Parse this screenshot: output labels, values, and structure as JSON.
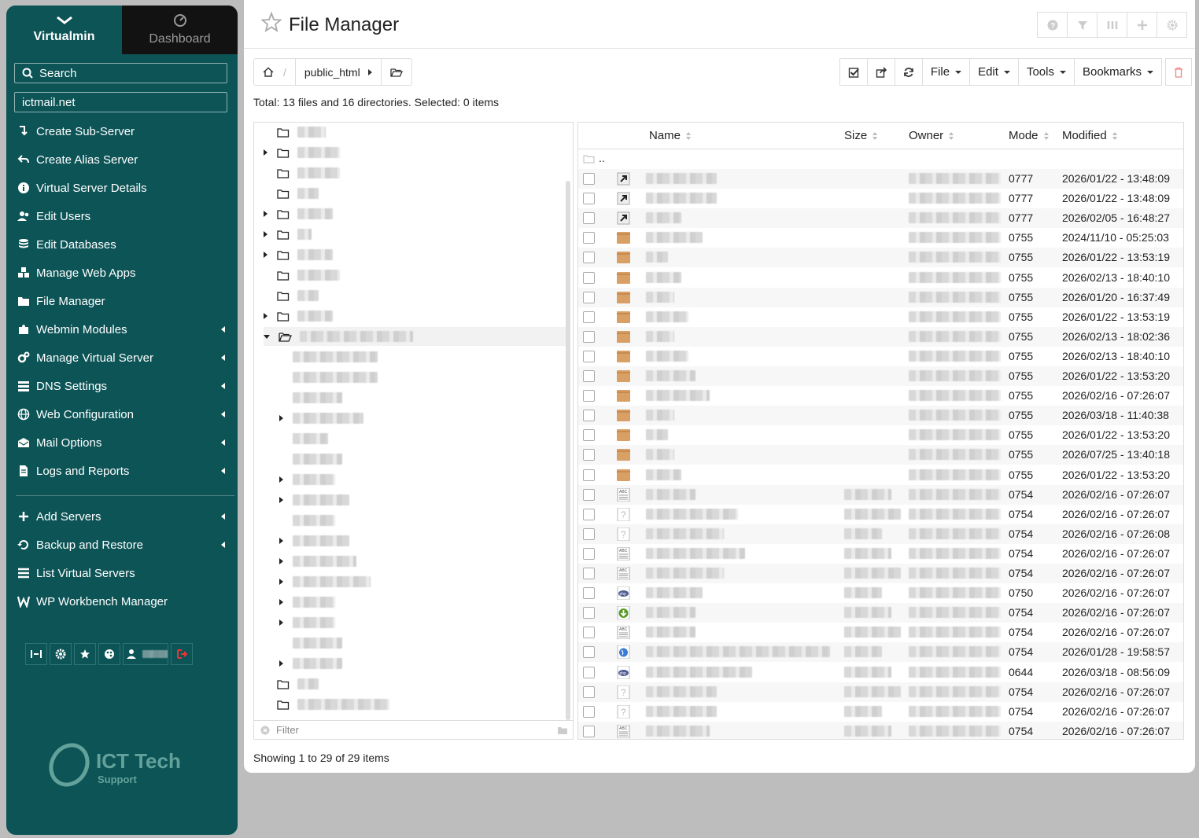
{
  "sidebar": {
    "tab_virtualmin": "Virtualmin",
    "tab_dashboard": "Dashboard",
    "search_placeholder": "Search",
    "domain": "ictmail.net",
    "items": [
      {
        "label": "Create Sub-Server",
        "icon": "level-down-icon",
        "arrow": false
      },
      {
        "label": "Create Alias Server",
        "icon": "reply-icon",
        "arrow": false
      },
      {
        "label": "Virtual Server Details",
        "icon": "info-icon",
        "arrow": false
      },
      {
        "label": "Edit Users",
        "icon": "users-icon",
        "arrow": false
      },
      {
        "label": "Edit Databases",
        "icon": "database-icon",
        "arrow": false
      },
      {
        "label": "Manage Web Apps",
        "icon": "cubes-icon",
        "arrow": false
      },
      {
        "label": "File Manager",
        "icon": "folder-icon",
        "arrow": false
      },
      {
        "label": "Webmin Modules",
        "icon": "puzzle-icon",
        "arrow": true
      },
      {
        "label": "Manage Virtual Server",
        "icon": "cogs-icon",
        "arrow": true
      },
      {
        "label": "DNS Settings",
        "icon": "server-icon",
        "arrow": true
      },
      {
        "label": "Web Configuration",
        "icon": "globe-icon",
        "arrow": true
      },
      {
        "label": "Mail Options",
        "icon": "envelope-icon",
        "arrow": true
      },
      {
        "label": "Logs and Reports",
        "icon": "file-icon",
        "arrow": true
      }
    ],
    "items2": [
      {
        "label": "Add Servers",
        "icon": "plus-icon",
        "arrow": true
      },
      {
        "label": "Backup and Restore",
        "icon": "backup-icon",
        "arrow": true
      },
      {
        "label": "List Virtual Servers",
        "icon": "list-icon",
        "arrow": false
      },
      {
        "label": "WP Workbench Manager",
        "icon": "wp-icon",
        "arrow": false
      }
    ]
  },
  "header": {
    "title": "File Manager"
  },
  "crumb": {
    "folder": "public_html"
  },
  "actions": {
    "file": "File",
    "edit": "Edit",
    "tools": "Tools",
    "bookmarks": "Bookmarks"
  },
  "summary": "Total: 13 files and 16 directories. Selected: 0 items",
  "tree": {
    "filter_placeholder": "Filter"
  },
  "table": {
    "headers": {
      "name": "Name",
      "size": "Size",
      "owner": "Owner",
      "mode": "Mode",
      "modified": "Modified"
    },
    "parent": "..",
    "rows": [
      {
        "type": "link",
        "mode": "0777",
        "modified": "2026/01/22 - 13:48:09",
        "nw": 90
      },
      {
        "type": "link",
        "mode": "0777",
        "modified": "2026/01/22 - 13:48:09",
        "nw": 90
      },
      {
        "type": "link",
        "mode": "0777",
        "modified": "2026/02/05 - 16:48:27",
        "nw": 45
      },
      {
        "type": "folder",
        "mode": "0755",
        "modified": "2024/11/10 - 05:25:03",
        "nw": 72
      },
      {
        "type": "folder",
        "mode": "0755",
        "modified": "2026/01/22 - 13:53:19",
        "nw": 28
      },
      {
        "type": "folder",
        "mode": "0755",
        "modified": "2026/02/13 - 18:40:10",
        "nw": 45
      },
      {
        "type": "folder",
        "mode": "0755",
        "modified": "2026/01/20 - 16:37:49",
        "nw": 36
      },
      {
        "type": "folder",
        "mode": "0755",
        "modified": "2026/01/22 - 13:53:19",
        "nw": 54
      },
      {
        "type": "folder",
        "mode": "0755",
        "modified": "2026/02/13 - 18:02:36",
        "nw": 36
      },
      {
        "type": "folder",
        "mode": "0755",
        "modified": "2026/02/13 - 18:40:10",
        "nw": 54
      },
      {
        "type": "folder",
        "mode": "0755",
        "modified": "2026/01/22 - 13:53:20",
        "nw": 63
      },
      {
        "type": "folder",
        "mode": "0755",
        "modified": "2026/02/16 - 07:26:07",
        "nw": 81
      },
      {
        "type": "folder",
        "mode": "0755",
        "modified": "2026/03/18 - 11:40:38",
        "nw": 36
      },
      {
        "type": "folder",
        "mode": "0755",
        "modified": "2026/01/22 - 13:53:20",
        "nw": 28
      },
      {
        "type": "folder",
        "mode": "0755",
        "modified": "2026/07/25 - 13:40:18",
        "nw": 36
      },
      {
        "type": "folder",
        "mode": "0755",
        "modified": "2026/01/22 - 13:53:20",
        "nw": 45
      },
      {
        "type": "text",
        "mode": "0754",
        "modified": "2026/02/16 - 07:26:07",
        "nw": 63
      },
      {
        "type": "unknown",
        "mode": "0754",
        "modified": "2026/02/16 - 07:26:07",
        "nw": 117
      },
      {
        "type": "unknown",
        "mode": "0754",
        "modified": "2026/02/16 - 07:26:08",
        "nw": 99
      },
      {
        "type": "text",
        "mode": "0754",
        "modified": "2026/02/16 - 07:26:07",
        "nw": 126
      },
      {
        "type": "text",
        "mode": "0754",
        "modified": "2026/02/16 - 07:26:07",
        "nw": 99
      },
      {
        "type": "php",
        "mode": "0750",
        "modified": "2026/02/16 - 07:26:07",
        "nw": 72
      },
      {
        "type": "download",
        "mode": "0754",
        "modified": "2026/02/16 - 07:26:07",
        "nw": 63
      },
      {
        "type": "text",
        "mode": "0754",
        "modified": "2026/02/16 - 07:26:07",
        "nw": 63
      },
      {
        "type": "globe",
        "mode": "0754",
        "modified": "2026/01/28 - 19:58:57",
        "nw": 234
      },
      {
        "type": "php",
        "mode": "0644",
        "modified": "2026/03/18 - 08:56:09",
        "nw": 135
      },
      {
        "type": "unknown",
        "mode": "0754",
        "modified": "2026/02/16 - 07:26:07",
        "nw": 90
      },
      {
        "type": "unknown",
        "mode": "0754",
        "modified": "2026/02/16 - 07:26:07",
        "nw": 90
      },
      {
        "type": "text",
        "mode": "0754",
        "modified": "2026/02/16 - 07:26:07",
        "nw": 81
      }
    ]
  },
  "footer": "Showing 1 to 29 of 29 items",
  "colors": {
    "sidebar": "#0d5457",
    "folder": "#d9a066"
  }
}
